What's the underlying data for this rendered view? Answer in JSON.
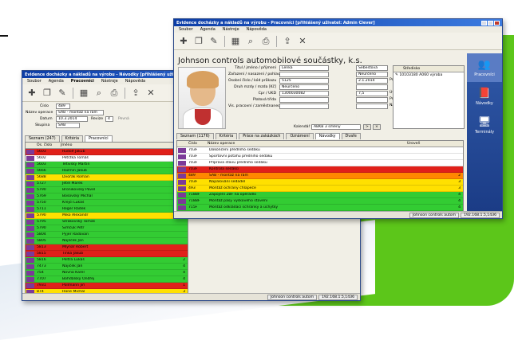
{
  "colors": {
    "red": "#e0201a",
    "orange": "#ff8800",
    "yellow": "#ffe000",
    "green": "#33cc33",
    "white": "#ffffff",
    "pink": "#fcd6d4"
  },
  "back_window": {
    "title": "Evidence docházky a nákladů na výrobu - Návodky [přihlášený uživatel:",
    "menu": [
      "Soubor",
      "Agenda",
      "Pracovníci",
      "Nástroje",
      "Nápověda"
    ],
    "form": {
      "cislo_label": "Číslo",
      "cislo_value": "489",
      "nazev_label": "Název operace",
      "nazev_value": "SAB - montáž na rám",
      "datum_label": "Datum",
      "datum_value": "10.3.2014",
      "revize_label": "Revize",
      "revize_value": "4",
      "pevna_label": "Pevná",
      "skupina_label": "Skupina",
      "skupina_value": "SAB"
    },
    "tabs": [
      "Seznam (247)",
      "Kritéria",
      "Pracovníci"
    ],
    "columns": [
      "Os. číslo",
      "Jméno"
    ],
    "rows": [
      {
        "id": "5603",
        "name": "Rudolf Jakub",
        "color": "red",
        "v": ""
      },
      {
        "id": "5602",
        "name": "Petržka Tomáš",
        "color": "white",
        "v": ""
      },
      {
        "id": "5603",
        "name": "Tětivský Martin",
        "color": "green",
        "v": ""
      },
      {
        "id": "5666",
        "name": "Rozmín Jakub",
        "color": "green",
        "v": ""
      },
      {
        "id": "5688",
        "name": "Dvořák Roman",
        "color": "yellow",
        "v": ""
      },
      {
        "id": "5727",
        "name": "Jetel Marek",
        "color": "green",
        "v": ""
      },
      {
        "id": "5790",
        "name": "Bronikovský Pavel",
        "color": "green",
        "v": ""
      },
      {
        "id": "5769",
        "name": "Bosovský Michal",
        "color": "green",
        "v": ""
      },
      {
        "id": "5750",
        "name": "Krejčí Lukáš",
        "color": "green",
        "v": ""
      },
      {
        "id": "5711",
        "name": "Řeger Radek",
        "color": "green",
        "v": ""
      },
      {
        "id": "5790",
        "name": "Miko Alexandr",
        "color": "yellow",
        "v": ""
      },
      {
        "id": "5795",
        "name": "Strakovský Tomáš",
        "color": "green",
        "v": ""
      },
      {
        "id": "5790",
        "name": "Šimčuk Petr",
        "color": "green",
        "v": ""
      },
      {
        "id": "5804",
        "name": "Pyjer Radovan",
        "color": "green",
        "v": ""
      },
      {
        "id": "5805",
        "name": "Najlíček Jan",
        "color": "green",
        "v": ""
      },
      {
        "id": "5813",
        "name": "Mlynář Robert",
        "color": "red",
        "v": ""
      },
      {
        "id": "5815",
        "name": "Tinka Jakub",
        "color": "red",
        "v": ""
      },
      {
        "id": "5816",
        "name": "Peltra Lukáš",
        "color": "green",
        "v": "2"
      },
      {
        "id": "7473",
        "name": "Najiček Jan",
        "color": "green",
        "v": "4"
      },
      {
        "id": "754",
        "name": "Novna Karel",
        "color": "green",
        "v": "4"
      },
      {
        "id": "7707",
        "name": "Bohdálský Ondřej",
        "color": "green",
        "v": "4"
      },
      {
        "id": "7931",
        "name": "Pollmann Jiří",
        "color": "red",
        "v": "1"
      },
      {
        "id": "874",
        "name": "Hone Michal",
        "color": "yellow",
        "v": "3"
      }
    ],
    "status": [
      "Johnson controls autom",
      "192.168.1.5,1436"
    ]
  },
  "front_window": {
    "title": "Evidence docházky a nákladů na výrobu - Pracovníci [přihlášený uživatel: Admin Clever]",
    "menu": [
      "Soubor",
      "Agenda",
      "Nástroje",
      "Nápověda"
    ],
    "company": "Johnson controls automobilové součástky, k.s.",
    "fields": [
      {
        "label": "Titul / jméno / příjmení",
        "value": "Lenka",
        "value2": "Šebestová"
      },
      {
        "label": "Zařazení / nasazení / pohlaví",
        "value": "",
        "value2": "Neurčeno"
      },
      {
        "label": "Osobní číslo / kód průkazu",
        "value": "5125",
        "value2": "2.1.2014"
      },
      {
        "label": "Druh mzdy / mzda [Kč]",
        "value": "Neurčeno",
        "value2": ""
      },
      {
        "label": "Cpr / UKD",
        "value": "1300030082",
        "value2": "7,5"
      },
      {
        "label": "Platová třída",
        "value": "",
        "value2": ""
      },
      {
        "label": "Vis. pracovní / zaměstnanec",
        "value": "",
        "value2": ""
      }
    ],
    "right_labels": [
      "Poč. pomoc od",
      "Úvazek (h)",
      "Prémie [%]",
      "Nárok na dovolenou [dny]"
    ],
    "kalendar_label": "Kalendář",
    "kalendar_value": "ABKB 3 směny",
    "stredisko_header": "Středisko",
    "stredisko_item": "10103180 A060 výroba",
    "tabs": [
      "Seznam (1176)",
      "Kritéria",
      "Práce na zakázkách",
      "Oznámení",
      "Návodky",
      "Dvaře"
    ],
    "columns": [
      "Číslo",
      "Název operace",
      "Úroveň"
    ],
    "rows": [
      {
        "cislo": "703F",
        "nazev": "Dokončení předního sedáku",
        "color": "white",
        "v": ""
      },
      {
        "cislo": "703F",
        "nazev": "Sportovní potahu předního sedáku",
        "color": "white",
        "v": ""
      },
      {
        "cislo": "703F",
        "nazev": "Příprava stavu předního sedáku",
        "color": "white",
        "v": ""
      },
      {
        "cislo": "703F",
        "nazev": "Kontrola sedáků",
        "color": "red",
        "v": ""
      },
      {
        "cislo": "489",
        "nazev": "SAB - montáž na rám",
        "color": "orange",
        "v": "2"
      },
      {
        "cislo": "703F",
        "nazev": "Napalování sedadel",
        "color": "yellow",
        "v": "3"
      },
      {
        "cislo": "493",
        "nazev": "Montáž ochrany chlapeče",
        "color": "yellow",
        "v": "3"
      },
      {
        "cislo": "718BF",
        "nazev": "Zapojení 2BF na opěradlo",
        "color": "green",
        "v": "4"
      },
      {
        "cislo": "718BF",
        "nazev": "Montáž pásy výškového stavění",
        "color": "green",
        "v": "4"
      },
      {
        "cislo": "715F",
        "nazev": "Montáž odkládací schránky a úchytky",
        "color": "green",
        "v": "4"
      },
      {
        "cislo": "713F",
        "nazev": "Montáž bočních plastů",
        "color": "green",
        "v": "4"
      },
      {
        "cislo": "715F",
        "nazev": "Zapojení elektroinstalace",
        "color": "green",
        "v": "4"
      },
      {
        "cislo": "3445",
        "nazev": "Montáž platové pásy VST",
        "color": "green",
        "v": "4"
      },
      {
        "cislo": "3447",
        "nazev": "Montáž odkládací schránky",
        "color": "green",
        "v": "4"
      }
    ],
    "sidebar": [
      "Pracovníci",
      "Návodky",
      "Terminály"
    ],
    "status": [
      "Johnson controls autom",
      "192.168.1.5,1436"
    ]
  }
}
